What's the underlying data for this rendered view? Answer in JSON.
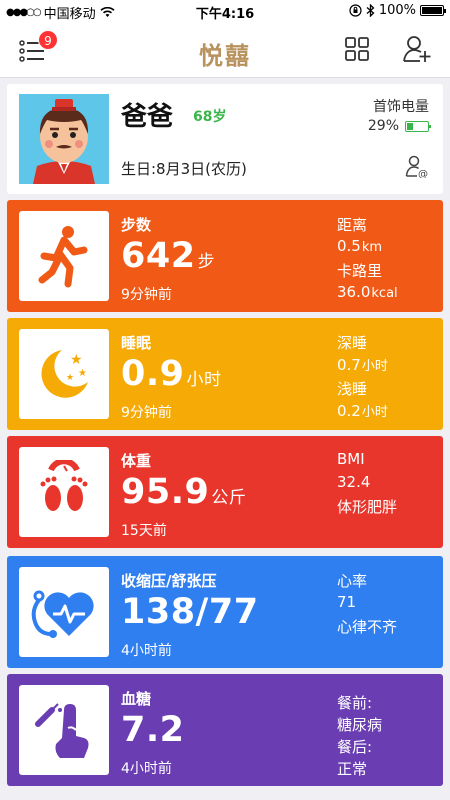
{
  "status": {
    "carrier": "中国移动",
    "time": "下午4:16",
    "battery": "100%"
  },
  "nav": {
    "title": "悦囍",
    "badge": "9"
  },
  "profile": {
    "name": "爸爸",
    "age": "68岁",
    "birthday": "生日:8月3日(农历)",
    "jewelry_label": "首饰电量",
    "jewelry_battery": "29%"
  },
  "cards": [
    {
      "color": "#f05a16",
      "label": "步数",
      "value": "642",
      "unit": "步",
      "ago": "9分钟前",
      "r1": "距离",
      "r2": "0.5",
      "r2u": "km",
      "r3": "卡路里",
      "r4": "36.0",
      "r4u": "kcal",
      "icon": "walking-person-icon"
    },
    {
      "color": "#f6aa06",
      "label": "睡眠",
      "value": "0.9",
      "unit": "小时",
      "ago": "9分钟前",
      "r1": "深睡",
      "r2": "0.7",
      "r2u": "小时",
      "r3": "浅睡",
      "r4": "0.2",
      "r4u": "小时",
      "icon": "moon-stars-icon"
    },
    {
      "color": "#e8362c",
      "label": "体重",
      "value": "95.9",
      "unit": "公斤",
      "ago": "15天前",
      "r1": "BMI",
      "r2": "32.4",
      "r2u": "",
      "r3": "体形肥胖",
      "r4": "",
      "r4u": "",
      "icon": "scale-feet-icon"
    },
    {
      "color": "#2f7ff0",
      "label": "收缩压/舒张压",
      "value": "138/77",
      "unit": "",
      "ago": "4小时前",
      "r1": "心率",
      "r2": "71",
      "r2u": "",
      "r3": "心律不齐",
      "r4": "",
      "r4u": "",
      "icon": "blood-pressure-heart-icon"
    },
    {
      "color": "#6a3db3",
      "label": "血糖",
      "value": "7.2",
      "unit": "",
      "ago": "4小时前",
      "r1": "餐前:",
      "r2": "糖尿病",
      "r2u": "",
      "r3": "餐后:",
      "r4": "正常",
      "r4u": "",
      "icon": "finger-lancet-icon"
    }
  ]
}
